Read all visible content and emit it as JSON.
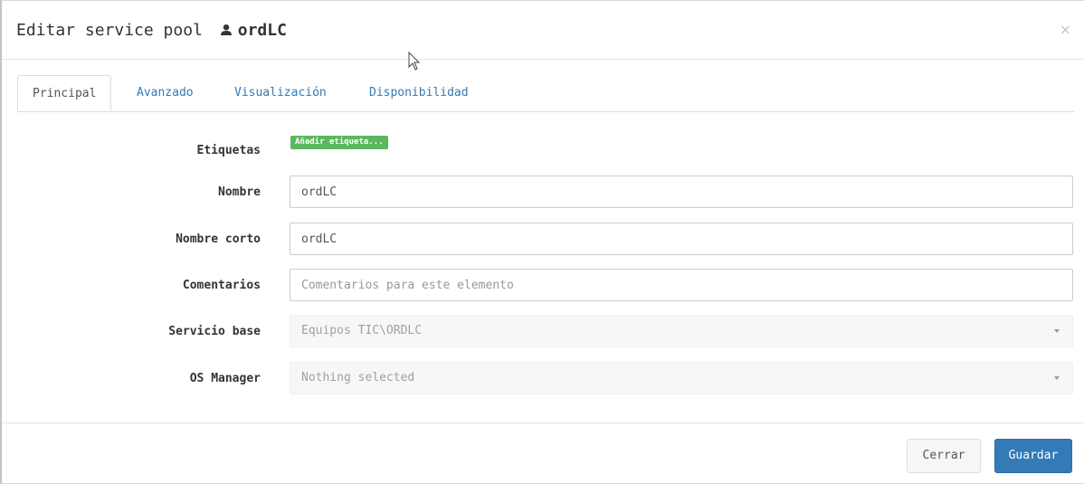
{
  "header": {
    "title": "Editar service pool",
    "pool_name": "ordLC",
    "pool_icon": "user-icon",
    "close_label": "×"
  },
  "tabs": [
    {
      "label": "Principal",
      "active": true
    },
    {
      "label": "Avanzado",
      "active": false
    },
    {
      "label": "Visualización",
      "active": false
    },
    {
      "label": "Disponibilidad",
      "active": false
    }
  ],
  "form": {
    "tags": {
      "label": "Etiquetas",
      "button": "Añadir etiqueta..."
    },
    "name": {
      "label": "Nombre",
      "value": "ordLC"
    },
    "short_name": {
      "label": "Nombre corto",
      "value": "ordLC"
    },
    "comments": {
      "label": "Comentarios",
      "value": "",
      "placeholder": "Comentarios para este elemento"
    },
    "base_service": {
      "label": "Servicio base",
      "value": "Equipos TIC\\ORDLC"
    },
    "os_manager": {
      "label": "OS Manager",
      "value": "Nothing selected"
    }
  },
  "footer": {
    "close_label": "Cerrar",
    "save_label": "Guardar"
  },
  "colors": {
    "primary": "#337ab7",
    "tag_green": "#5cb85c"
  }
}
